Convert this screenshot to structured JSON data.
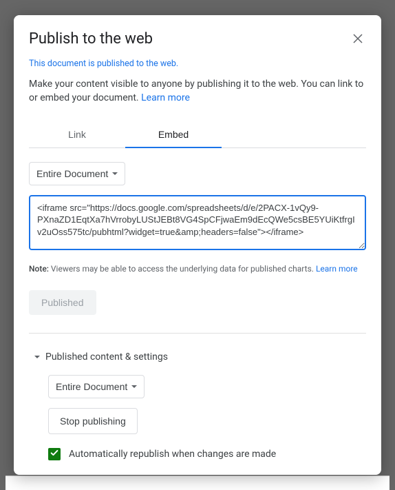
{
  "dialog": {
    "title": "Publish to the web",
    "status_text": "This document is published to the web.",
    "description": "Make your content visible to anyone by publishing it to the web. You can link to or embed your document. ",
    "learn_more": "Learn more"
  },
  "tabs": {
    "link": "Link",
    "embed": "Embed"
  },
  "embed_panel": {
    "scope_dropdown": "Entire Document",
    "textarea_value": "<iframe src=\"https://docs.google.com/spreadsheets/d/e/2PACX-1vQy9-PXnaZD1EqtXa7hVrrobyLUStJEBt8VG4SpCFjwaEm9dEcQWe5csBE5YUiKtfrgIv2uOss575tc/pubhtml?widget=true&amp;headers=false\"></iframe>"
  },
  "note": {
    "label": "Note:",
    "text": " Viewers may be able to access the underlying data for published charts. ",
    "learn_more": "Learn more"
  },
  "published_button": "Published",
  "settings": {
    "header": "Published content & settings",
    "scope_dropdown": "Entire Document",
    "stop_button": "Stop publishing",
    "auto_republish": "Automatically republish when changes are made"
  }
}
